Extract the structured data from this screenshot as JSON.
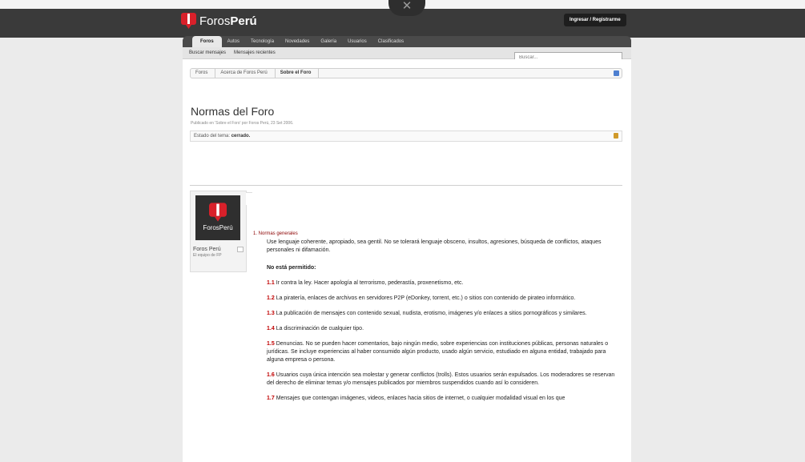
{
  "header": {
    "close_glyph": "✕",
    "logo": {
      "part1": "Foros",
      "part2": "Perú"
    },
    "login_label": "Ingresar / Registrarme"
  },
  "nav": {
    "tabs": [
      {
        "label": "Foros",
        "active": true
      },
      {
        "label": "Autos"
      },
      {
        "label": "Tecnología"
      },
      {
        "label": "Novedades"
      },
      {
        "label": "Galería"
      },
      {
        "label": "Usuarios"
      },
      {
        "label": "Clasificados"
      }
    ],
    "sublinks": [
      "Buscar mensajes",
      "Mensajes recientes"
    ],
    "search_placeholder": "Buscar..."
  },
  "breadcrumb": [
    "Foros",
    "Acerca de Foros Perú",
    "Sobre el Foro"
  ],
  "thread": {
    "title": "Normas del Foro",
    "byline": "Publicado en 'Sobre el Foro' por Foros Perú, 23 Set 2006.",
    "status_label": "Estado del tema:",
    "status_value": "cerrado."
  },
  "author": {
    "avatar_text": "ForosPerú",
    "name": "Foros Perú",
    "title": "El equipo de FP"
  },
  "post": {
    "section": "1. Normas generales",
    "intro": "Use lenguaje coherente, apropiado, sea gentil. No se tolerará lenguaje obsceno, insultos, agresiones, búsqueda de conflictos, ataques personales ni difamación.",
    "not_allowed": "No está permitido:",
    "rules": [
      {
        "num": "1.1",
        "text": "Ir contra la ley. Hacer apología al terrorismo, pederastía, proxenetismo, etc."
      },
      {
        "num": "1.2",
        "text": "La piratería, enlaces de archivos en servidores P2P (eDonkey, torrent, etc.) o sitios con contenido de pirateo informático."
      },
      {
        "num": "1.3",
        "text": "La publicación de mensajes con contenido sexual, nudista, erotismo, imágenes y/o enlaces a sitios pornográficos y similares."
      },
      {
        "num": "1.4",
        "text": "La discriminación de cualquier tipo."
      },
      {
        "num": "1.5",
        "text": "Denuncias. No se pueden hacer comentarios, bajo ningún medio, sobre experiencias con instituciones públicas, personas naturales o jurídicas. Se incluye experiencias al haber consumido algún producto, usado algún servicio, estudiado en alguna entidad, trabajado para alguna empresa o persona."
      },
      {
        "num": "1.6",
        "text": "Usuarios cuya única intención sea molestar y generar conflictos (trolls). Estos usuarios serán expulsados. Los moderadores se reservan del derecho de eliminar temas y/o mensajes publicados por miembros suspendidos cuando así lo consideren."
      },
      {
        "num": "1.7",
        "text": "Mensajes que contengan imágenes, videos, enlaces hacia sitios de internet, o cualquier modalidad visual en los que"
      }
    ]
  }
}
